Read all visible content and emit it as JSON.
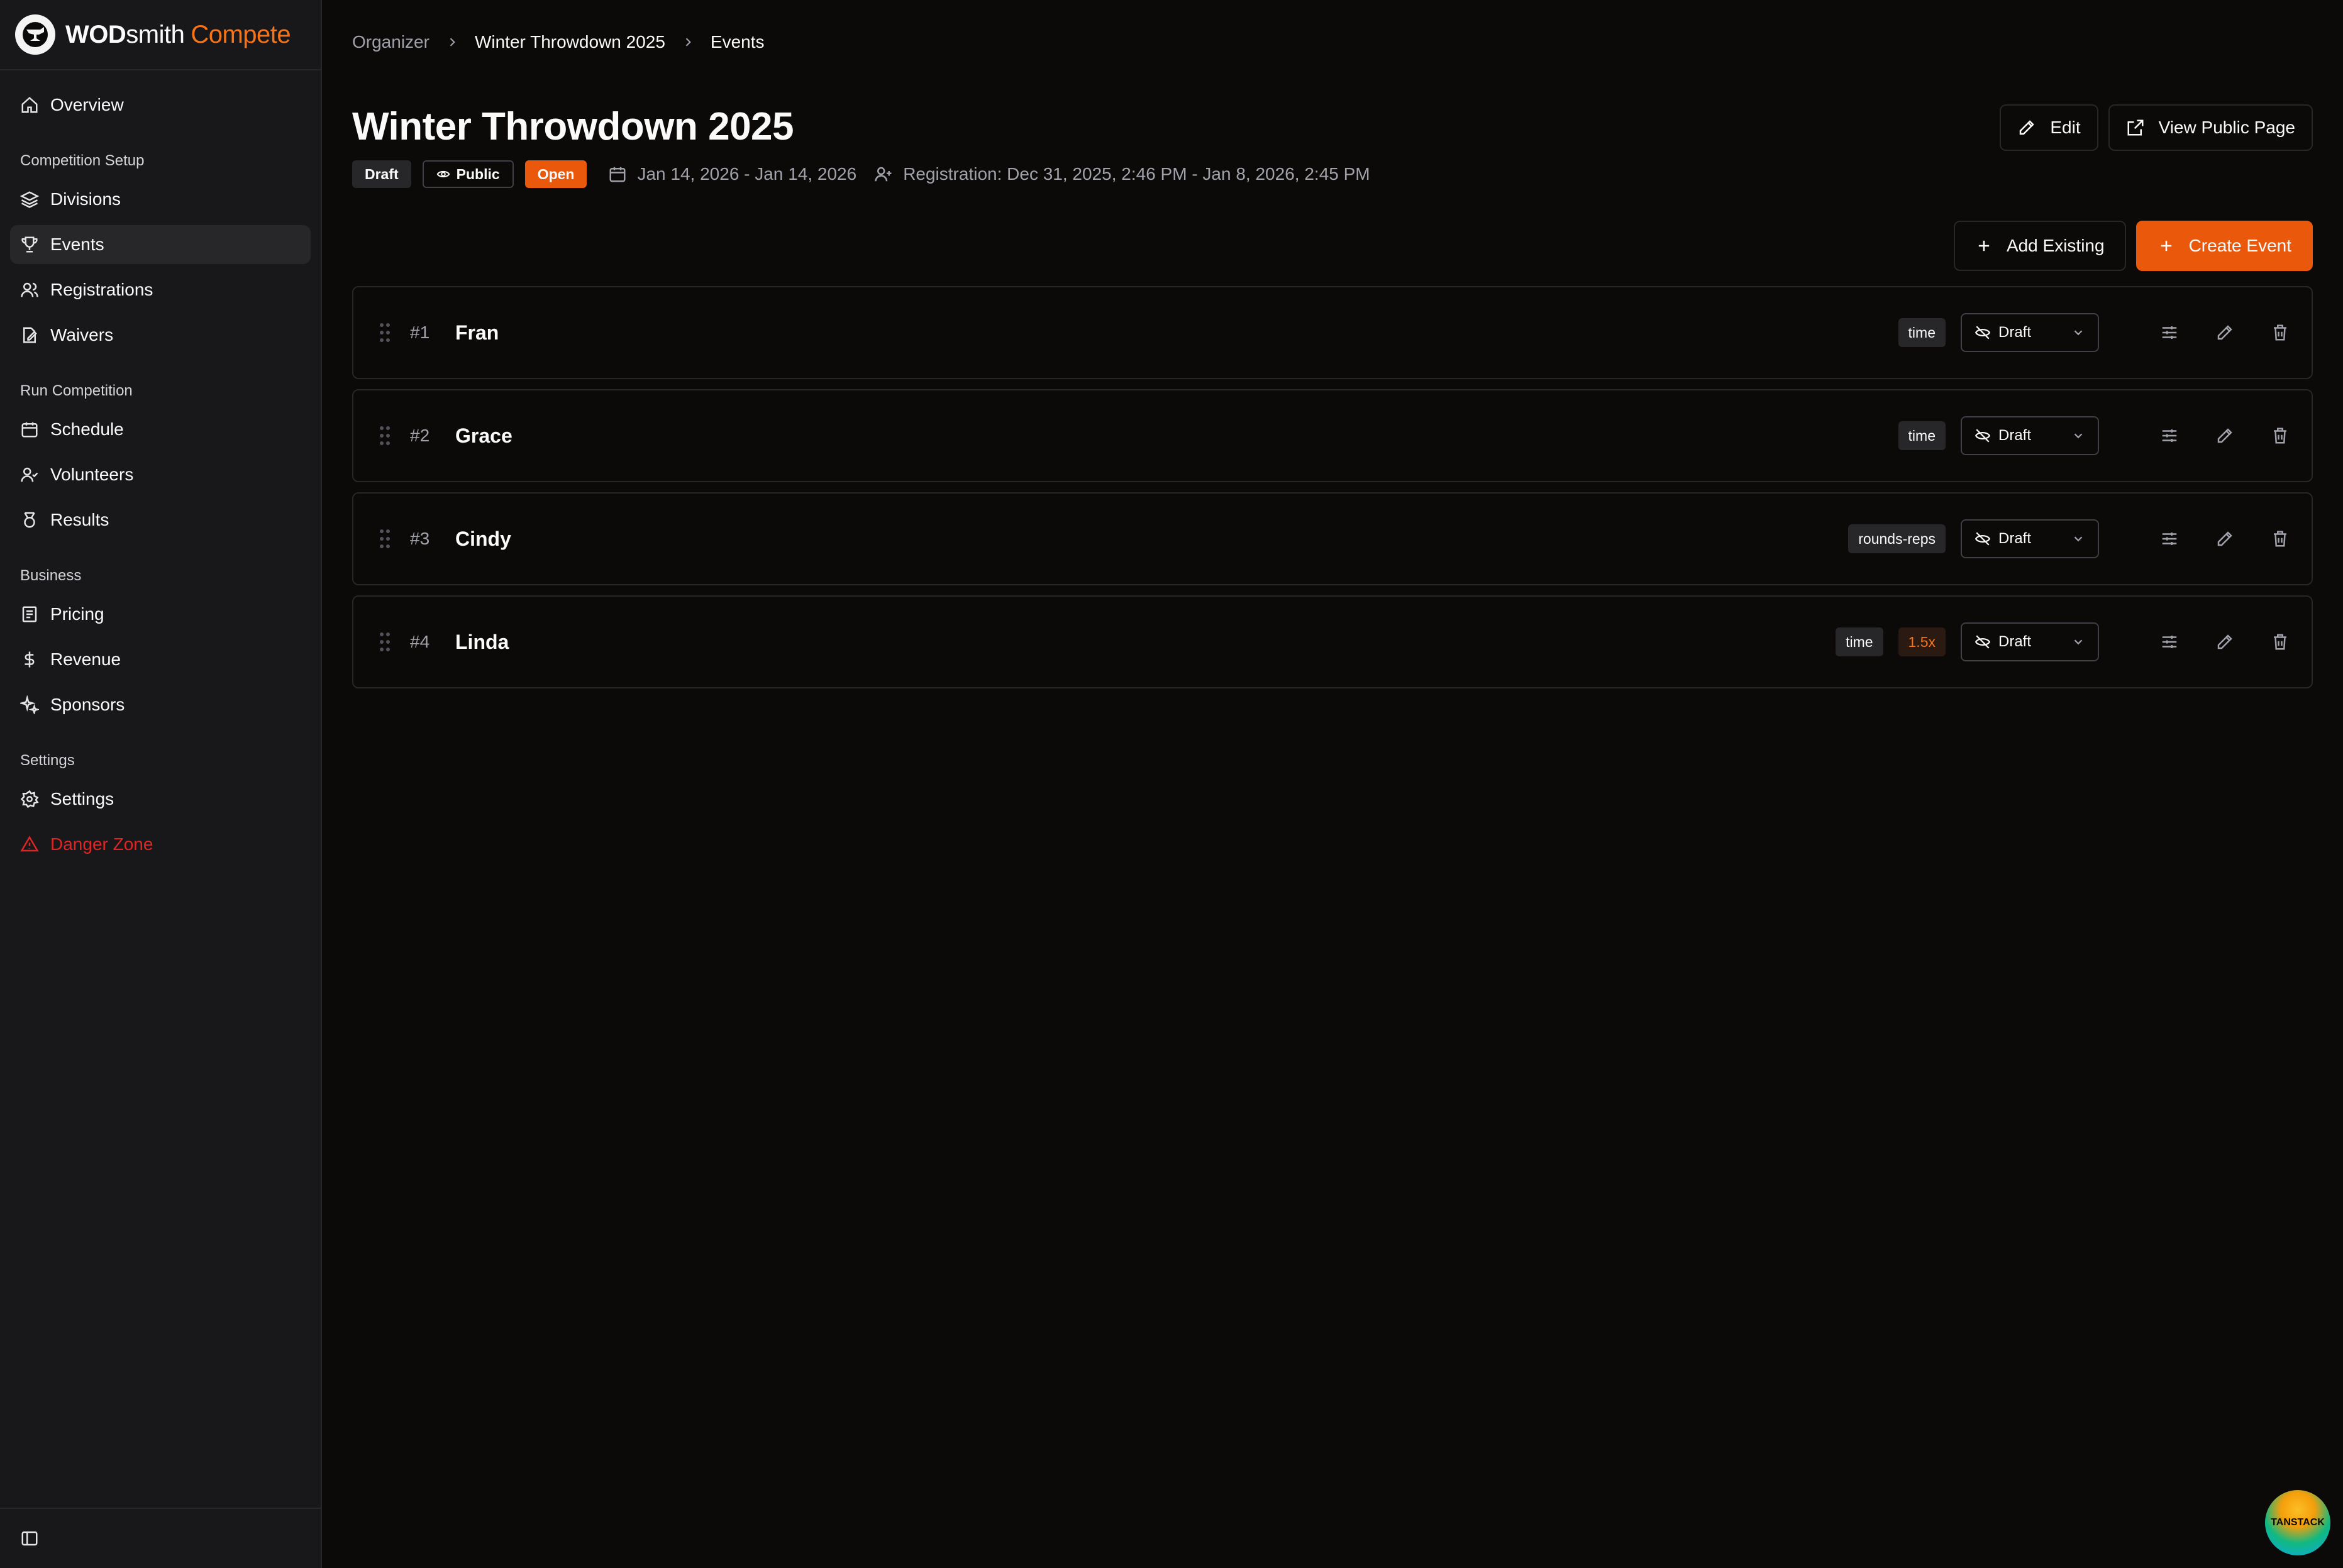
{
  "brand": {
    "name_bold": "WOD",
    "name_light": "smith",
    "name_accent": "Compete"
  },
  "sidebar": {
    "overview": "Overview",
    "sections": {
      "setup": "Competition Setup",
      "run": "Run Competition",
      "business": "Business",
      "settings": "Settings"
    },
    "items": {
      "divisions": "Divisions",
      "events": "Events",
      "registrations": "Registrations",
      "waivers": "Waivers",
      "schedule": "Schedule",
      "volunteers": "Volunteers",
      "results": "Results",
      "pricing": "Pricing",
      "revenue": "Revenue",
      "sponsors": "Sponsors",
      "settings": "Settings",
      "danger": "Danger Zone"
    }
  },
  "breadcrumb": [
    "Organizer",
    "Winter Throwdown 2025",
    "Events"
  ],
  "header": {
    "title": "Winter Throwdown 2025",
    "badges": {
      "draft": "Draft",
      "public": "Public",
      "open": "Open"
    },
    "dates": "Jan 14, 2026 - Jan 14, 2026",
    "registration": "Registration: Dec 31, 2025, 2:46 PM - Jan 8, 2026, 2:45 PM",
    "edit_label": "Edit",
    "view_public_label": "View Public Page"
  },
  "toolbar": {
    "add_existing": "Add Existing",
    "create_event": "Create Event"
  },
  "events": [
    {
      "num": "#1",
      "name": "Fran",
      "tag": "time",
      "multiplier": "",
      "status": "Draft"
    },
    {
      "num": "#2",
      "name": "Grace",
      "tag": "time",
      "multiplier": "",
      "status": "Draft"
    },
    {
      "num": "#3",
      "name": "Cindy",
      "tag": "rounds-reps",
      "multiplier": "",
      "status": "Draft"
    },
    {
      "num": "#4",
      "name": "Linda",
      "tag": "time",
      "multiplier": "1.5x",
      "status": "Draft"
    }
  ],
  "badge_logo": "TANSTACK",
  "colors": {
    "accent": "#ea580c",
    "danger": "#dc2626",
    "background": "#0b0a09",
    "sidebar": "#18181b"
  }
}
